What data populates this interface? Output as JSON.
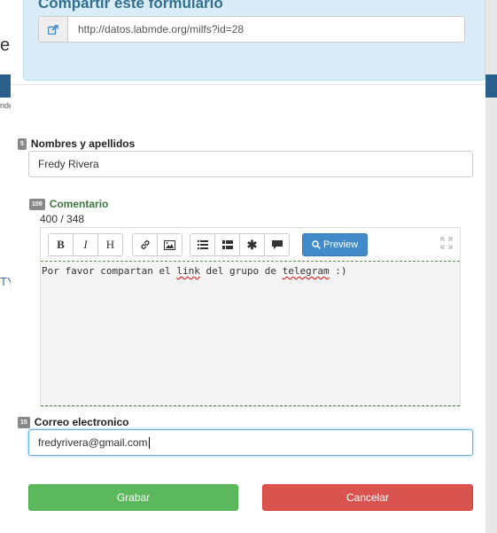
{
  "background": {
    "left_text_e": "e",
    "left_text_nde": "nde",
    "left_text_ty": "TY"
  },
  "share": {
    "title": "Compartir este formulario",
    "url": "http://datos.labmde.org/milfs?id=28",
    "icon": "share-icon"
  },
  "fields": {
    "nombres": {
      "number": "5",
      "label": "Nombres y apellidos",
      "value": "Fredy Rivera"
    },
    "comentario": {
      "number": "109",
      "label": "Comentario",
      "counter": "400 / 348",
      "text": "Por favor compartan el link del grupo de telegram :)",
      "toolbar": {
        "bold": "B",
        "italic": "I",
        "heading": "H",
        "link_icon": "link-icon",
        "image_icon": "image-icon",
        "unordered_list_icon": "unordered-list-icon",
        "ordered_list_icon": "ordered-list-icon",
        "asterisk_icon": "asterisk-icon",
        "comment_icon": "comment-icon",
        "preview": "Preview",
        "fullscreen_icon": "fullscreen-icon"
      }
    },
    "correo": {
      "number": "15",
      "label": "Correo electronico",
      "value": "fredyrivera@gmail.com"
    }
  },
  "actions": {
    "save": "Grabar",
    "cancel": "Cancelar"
  },
  "colors": {
    "share_bg": "#d9ecf7",
    "share_title": "#31708f",
    "label_green": "#3c763d",
    "save": "#5cb85c",
    "cancel": "#d9534f",
    "preview": "#428bca"
  }
}
